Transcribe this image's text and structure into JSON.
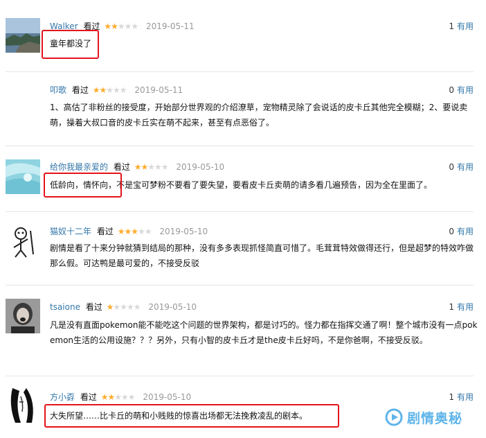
{
  "reviews": [
    {
      "user": "Walker",
      "watched": "看过",
      "rating": 2,
      "date": "2019-05-11",
      "votes": "1",
      "vote_label": "有用",
      "text": "童年都没了"
    },
    {
      "user": "叩歌",
      "watched": "看过",
      "rating": 2,
      "date": "2019-05-11",
      "votes": "0",
      "vote_label": "有用",
      "text": "1、高估了非粉丝的接受度，开始部分世界观的介绍潦草，宠物精灵除了会说话的皮卡丘其他完全模糊；2、要说卖萌，操着大叔口音的皮卡丘实在萌不起来，甚至有点恶俗了。"
    },
    {
      "user": "给你我最亲爱的",
      "watched": "看过",
      "rating": 2,
      "date": "2019-05-10",
      "votes": "0",
      "vote_label": "有用",
      "text": "低龄向，情怀向，不是宝可梦粉不要看了要失望，要看皮卡丘卖萌的请多看几遍预告，因为全在里面了。"
    },
    {
      "user": "猫奴十二年",
      "watched": "看过",
      "rating": 3,
      "date": "2019-05-10",
      "votes": "0",
      "vote_label": "有用",
      "text": "剧情是看了十来分钟就猜到结局的那种，没有多多表现抓怪简直可惜了。毛茸茸特效做得还行，但是超梦的特效咋做那么假。可达鸭是最可爱的，不接受反驳"
    },
    {
      "user": "tsaione",
      "watched": "看过",
      "rating": 1,
      "date": "2019-05-10",
      "votes": "1",
      "vote_label": "有用",
      "text": "凡是没有直面pokemon能不能吃这个问题的世界架构，都是讨巧的。怪力都在指挥交通了啊！整个城市没有一点pokemon生活的公用设施？？？另外，只有小智的皮卡丘才是the皮卡丘好吗，不是你爸啊，不接受反驳。"
    },
    {
      "user": "方小孬",
      "watched": "看过",
      "rating": 2,
      "date": "2019-05-10",
      "votes": "1",
      "vote_label": "有用",
      "text": "大失所望……比卡丘的萌和小贱贱的惊喜出场都无法挽救凌乱的剧本。"
    }
  ],
  "star_glyph": "★",
  "watermark": {
    "text": "剧情奥秘",
    "icon": "play-logo-icon"
  },
  "colors": {
    "link": "#3377aa",
    "star": "#ffac2d",
    "highlight_box": "#e3131b",
    "watermark": "#5fb4ea"
  }
}
